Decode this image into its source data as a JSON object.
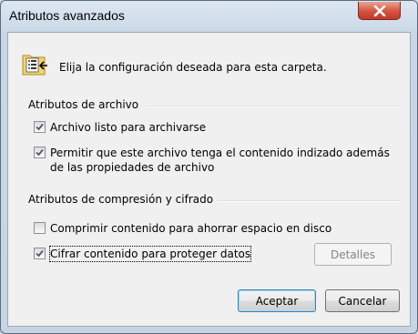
{
  "window": {
    "title": "Atributos avanzados"
  },
  "intro": {
    "text": "Elija la configuración deseada para esta carpeta."
  },
  "file_attributes": {
    "label": "Atributos de archivo",
    "archive": {
      "label": "Archivo listo para archivarse",
      "checked": true
    },
    "index": {
      "label": "Permitir que este archivo tenga el contenido indizado además de las propiedades de archivo",
      "checked": true
    }
  },
  "compression_attributes": {
    "label": "Atributos de compresión y cifrado",
    "compress": {
      "label": "Comprimir contenido para ahorrar espacio en disco",
      "checked": false
    },
    "encrypt": {
      "label": "Cifrar contenido para proteger datos",
      "checked": true
    },
    "details_label": "Detalles"
  },
  "buttons": {
    "ok_label": "Aceptar",
    "cancel_label": "Cancelar"
  },
  "icons": {
    "close": "close-icon",
    "folder": "folder-list-icon",
    "check": "check-icon"
  }
}
